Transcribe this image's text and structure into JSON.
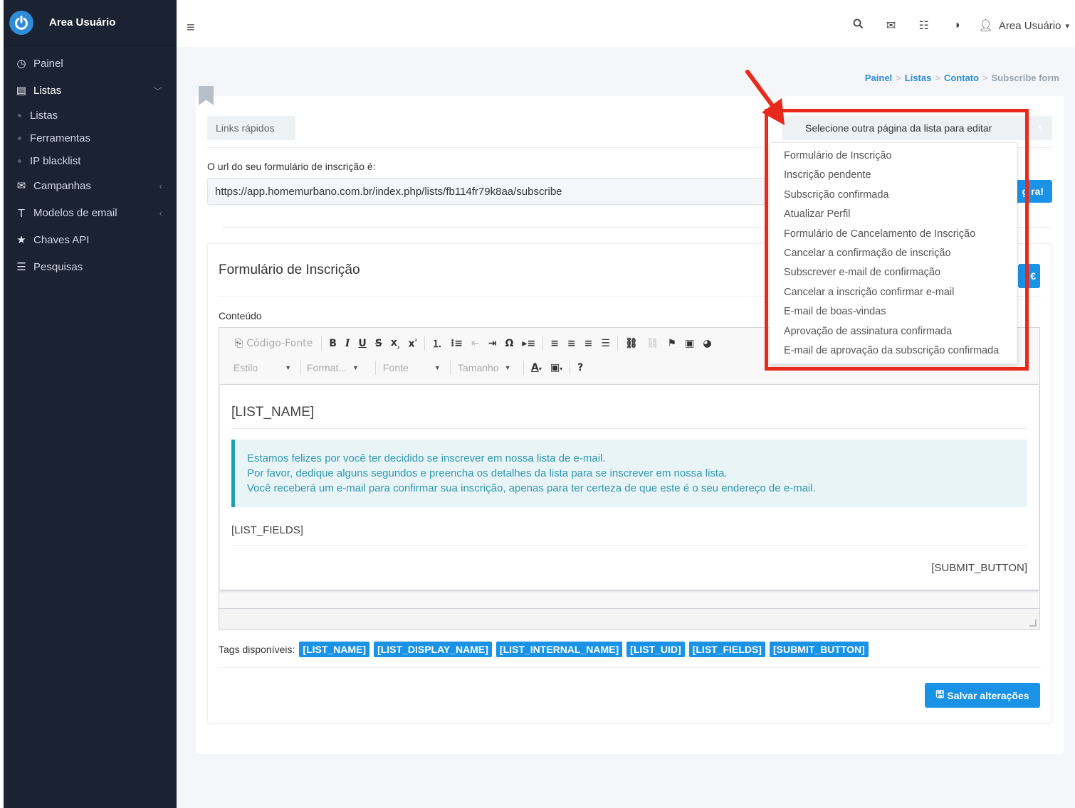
{
  "brand": {
    "name": "Area Usuário"
  },
  "sidebar": {
    "items": [
      {
        "label": "Painel",
        "icon": "dashboard-icon"
      },
      {
        "label": "Listas",
        "icon": "list-icon"
      },
      {
        "label": "Campanhas",
        "icon": "envelope-icon"
      },
      {
        "label": "Modelos de email",
        "icon": "text-icon"
      },
      {
        "label": "Chaves API",
        "icon": "star-icon"
      },
      {
        "label": "Pesquisas",
        "icon": "list-icon"
      }
    ],
    "sub_items": [
      "Listas",
      "Ferramentas",
      "IP blacklist"
    ]
  },
  "topbar": {
    "user_label": "Area Usuário"
  },
  "breadcrumb": {
    "items": [
      "Painel",
      "Listas",
      "Contato"
    ],
    "current": "Subscribe form"
  },
  "quick_links": "Links rápidos",
  "url_section": {
    "label": "O url do seu formulário de inscrição é:",
    "value": "https://app.homemurbano.com.br/index.php/lists/fb114fr79k8aa/subscribe",
    "button_label": "g ra!"
  },
  "page_select": {
    "label": "Selecione outra página da lista para editar",
    "options": [
      "Formulário de Inscrição",
      "Inscrição pendente",
      "Subscrição confirmada",
      "Atualizar Perfil",
      "Formulário de Cancelamento de Inscrição",
      "Cancelar a confirmação de inscrição",
      "Subscrever e-mail de confirmação",
      "Cancelar a inscrição confirmar e-mail",
      "E-mail de boas-vindas",
      "Aprovação de assinatura confirmada",
      "E-mail de aprovação da subscrição confirmada"
    ]
  },
  "panel": {
    "title": "Formulário de Inscrição",
    "content_label": "Conteúdo"
  },
  "editor": {
    "source_label": "Código-Fonte",
    "style_label": "Estilo",
    "format_label": "Format...",
    "font_label": "Fonte",
    "size_label": "Tamanho",
    "help_label": "?",
    "list_name": "[LIST_NAME]",
    "callout_lines": [
      "Estamos felizes por você ter decidido se inscrever em nossa lista de e-mail.",
      "Por favor, dedique alguns segundos e preencha os detalhes da lista para se inscrever em nossa lista.",
      "Você receberá um e-mail para confirmar sua inscrição, apenas para ter certeza de que este é o seu endereço de e-mail."
    ],
    "list_fields": "[LIST_FIELDS]",
    "submit_button": "[SUBMIT_BUTTON]"
  },
  "tags": {
    "label": "Tags disponíveis:",
    "items": [
      "[LIST_NAME]",
      "[LIST_DISPLAY_NAME]",
      "[LIST_INTERNAL_NAME]",
      "[LIST_UID]",
      "[LIST_FIELDS]",
      "[SUBMIT_BUTTON]"
    ]
  },
  "save_button": "Salvar alterações",
  "colors": {
    "accent": "#1a92e6",
    "sidebar": "#1b2232",
    "highlight": "#e8291e",
    "callout": "#2f98b2"
  }
}
